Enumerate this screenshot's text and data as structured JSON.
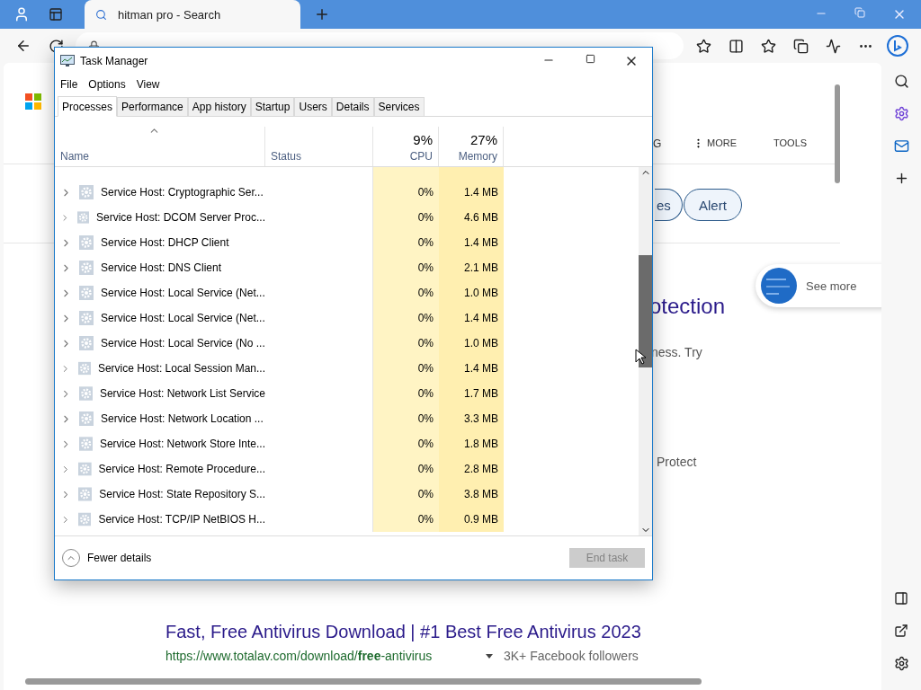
{
  "browser": {
    "tab": {
      "title": "hitman pro - Search",
      "selected": true
    }
  },
  "page": {
    "nav": [
      "G",
      "MORE",
      "TOOLS"
    ],
    "chips": [
      "es",
      "Alert"
    ],
    "card": "See more",
    "heading": "otection",
    "snippet": "ness. Try",
    "snippet2": "Protect",
    "result": {
      "title": "Fast, Free Antivirus Download | #1 Best Free Antivirus 2023",
      "url": "https://www.totalav.com/download/**free**-antivirus",
      "followers": "3K+ Facebook followers"
    }
  },
  "task_manager": {
    "title": "Task Manager",
    "menu": [
      "File",
      "Options",
      "View"
    ],
    "tabs": [
      {
        "label": "Processes",
        "selected": true
      },
      {
        "label": "Performance",
        "selected": false
      },
      {
        "label": "App history",
        "selected": false
      },
      {
        "label": "Startup",
        "selected": false
      },
      {
        "label": "Users",
        "selected": false
      },
      {
        "label": "Details",
        "selected": false
      },
      {
        "label": "Services",
        "selected": false
      }
    ],
    "columns": {
      "name": "Name",
      "status": "Status",
      "cpu_total": "9%",
      "cpu": "CPU",
      "memory_total": "27%",
      "memory": "Memory"
    },
    "rows": [
      {
        "kind": "service",
        "name": "Service Host: Cryptographic Ser...",
        "cpu": "0%",
        "memory": "1.4 MB"
      },
      {
        "kind": "service",
        "name": "Service Host: DCOM Server Proc...",
        "cpu": "0%",
        "memory": "4.6 MB"
      },
      {
        "kind": "service",
        "name": "Service Host: DHCP Client",
        "cpu": "0%",
        "memory": "1.4 MB"
      },
      {
        "kind": "service",
        "name": "Service Host: DNS Client",
        "cpu": "0%",
        "memory": "2.1 MB"
      },
      {
        "kind": "service",
        "name": "Service Host: Local Service (Net...",
        "cpu": "0%",
        "memory": "1.0 MB"
      },
      {
        "kind": "service",
        "name": "Service Host: Local Service (Net...",
        "cpu": "0%",
        "memory": "1.4 MB"
      },
      {
        "kind": "service",
        "name": "Service Host: Local Service (No ...",
        "cpu": "0%",
        "memory": "1.0 MB"
      },
      {
        "kind": "service",
        "name": "Service Host: Local Session Man...",
        "cpu": "0%",
        "memory": "1.4 MB"
      },
      {
        "kind": "service",
        "name": "Service Host: Network List Service",
        "cpu": "0%",
        "memory": "1.7 MB"
      },
      {
        "kind": "service",
        "name": "Service Host: Network Location ...",
        "cpu": "0%",
        "memory": "3.3 MB"
      },
      {
        "kind": "service",
        "name": "Service Host: Network Store Inte...",
        "cpu": "0%",
        "memory": "1.8 MB"
      },
      {
        "kind": "service",
        "name": "Service Host: Remote Procedure...",
        "cpu": "0%",
        "memory": "2.8 MB"
      },
      {
        "kind": "service",
        "name": "Service Host: State Repository S...",
        "cpu": "0%",
        "memory": "3.8 MB"
      },
      {
        "kind": "service",
        "name": "Service Host: TCP/IP NetBIOS H...",
        "cpu": "0%",
        "memory": "0.9 MB"
      }
    ],
    "footer": {
      "toggle": "Fewer details",
      "button": {
        "label": "End task",
        "disabled": true
      }
    }
  }
}
